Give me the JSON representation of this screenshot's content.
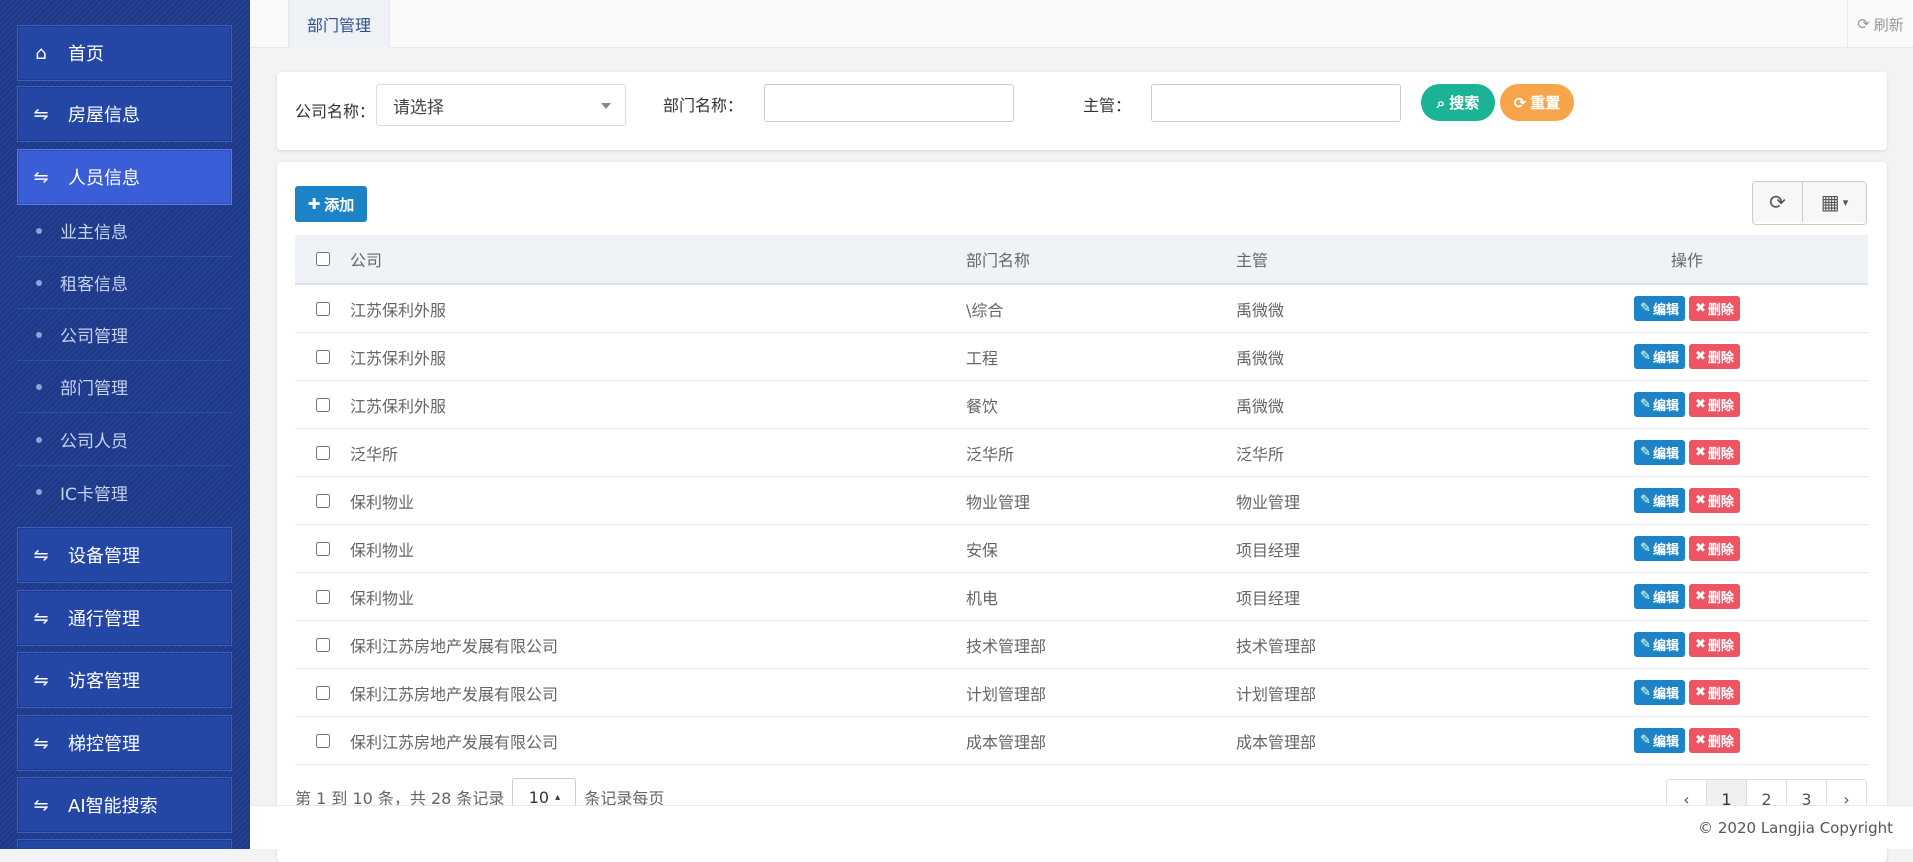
{
  "sidebar": {
    "items": [
      {
        "label": "首页",
        "icon": "home-icon"
      },
      {
        "label": "房屋信息",
        "icon": "exchange-icon"
      },
      {
        "label": "人员信息",
        "icon": "exchange-icon"
      },
      {
        "label": "设备管理",
        "icon": "exchange-icon"
      },
      {
        "label": "通行管理",
        "icon": "exchange-icon"
      },
      {
        "label": "访客管理",
        "icon": "exchange-icon"
      },
      {
        "label": "梯控管理",
        "icon": "exchange-icon"
      },
      {
        "label": "AI智能搜索",
        "icon": "exchange-icon"
      }
    ],
    "submenu": [
      "业主信息",
      "租客信息",
      "公司管理",
      "部门管理",
      "公司人员",
      "IC卡管理"
    ]
  },
  "tabs": {
    "active": "部门管理",
    "refresh": "刷新"
  },
  "search": {
    "company_label": "公司名称：",
    "company_value": "请选择",
    "dept_label": "部门名称：",
    "dept_value": "",
    "manager_label": "主管：",
    "manager_value": "",
    "search_btn": "搜索",
    "reset_btn": "重置"
  },
  "toolbar": {
    "add_label": "添加"
  },
  "table": {
    "columns": [
      "公司",
      "部门名称",
      "主管",
      "操作"
    ],
    "edit_label": "编辑",
    "delete_label": "删除",
    "rows": [
      [
        "江苏保利外服",
        "\\综合",
        "禹微微"
      ],
      [
        "江苏保利外服",
        "工程",
        "禹微微"
      ],
      [
        "江苏保利外服",
        "餐饮",
        "禹微微"
      ],
      [
        "泛华所",
        "泛华所",
        "泛华所"
      ],
      [
        "保利物业",
        "物业管理",
        "物业管理"
      ],
      [
        "保利物业",
        "安保",
        "项目经理"
      ],
      [
        "保利物业",
        "机电",
        "项目经理"
      ],
      [
        "保利江苏房地产发展有限公司",
        "技术管理部",
        "技术管理部"
      ],
      [
        "保利江苏房地产发展有限公司",
        "计划管理部",
        "计划管理部"
      ],
      [
        "保利江苏房地产发展有限公司",
        "成本管理部",
        "成本管理部"
      ]
    ]
  },
  "pagination": {
    "info_prefix": "第 1 到 10 条，共 28 条记录",
    "page_size": "10",
    "info_suffix": "条记录每页",
    "prev": "‹",
    "pages": [
      "1",
      "2",
      "3"
    ],
    "next": "›"
  },
  "footer": {
    "copyright": "© 2020 Langjia Copyright"
  },
  "colors": {
    "sidebar": "#1d3a8a",
    "primary": "#1c84c6",
    "success": "#1ab394",
    "warning": "#f7a54a",
    "danger": "#ed5565"
  }
}
